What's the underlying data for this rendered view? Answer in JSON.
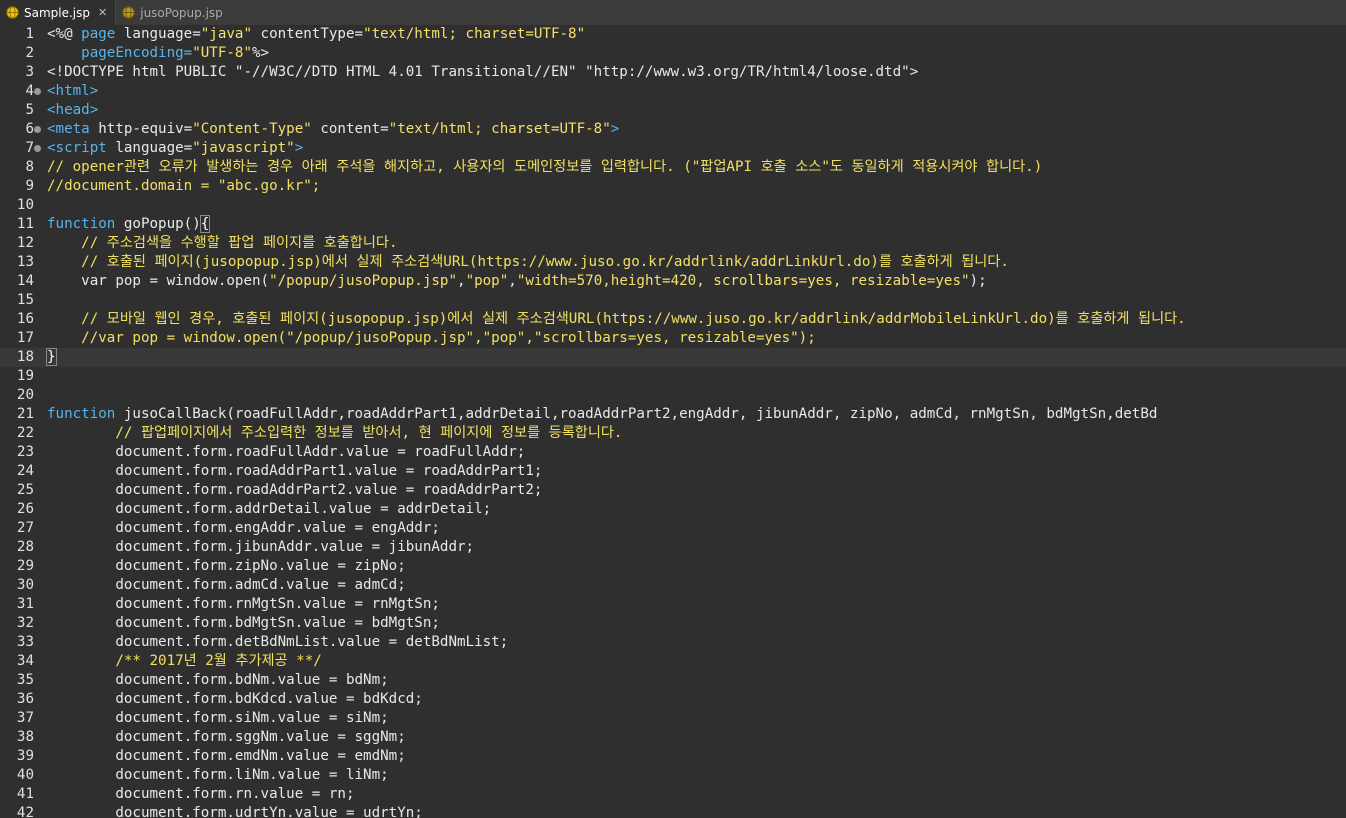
{
  "tabs": [
    {
      "label": "Sample.jsp",
      "icon": "jsp-file-icon",
      "active": true,
      "close": "✕"
    },
    {
      "label": "jusoPopup.jsp",
      "icon": "jsp-file-icon",
      "active": false
    }
  ],
  "colors": {
    "background": "#2f2f2f",
    "line_number": "#e0e0e0",
    "text": "#e8e8e8",
    "string": "#f4e06a",
    "tag": "#58b4ec",
    "comment": "#f0e060"
  },
  "editor": {
    "current_line": 18,
    "folded_lines": [
      4,
      6,
      7
    ],
    "lines": [
      {
        "n": "1",
        "segs": [
          [
            "<%@ ",
            "t-jsp"
          ],
          [
            "page",
            "t-tag"
          ],
          [
            " language=",
            "t-default"
          ],
          [
            "\"java\"",
            "t-str"
          ],
          [
            " contentType=",
            "t-default"
          ],
          [
            "\"text/html; charset=UTF-8\"",
            "t-str"
          ]
        ]
      },
      {
        "n": "2",
        "segs": [
          [
            "    pageEncoding=",
            "t-tag"
          ],
          [
            "\"UTF-8\"",
            "t-str"
          ],
          [
            "%>",
            "t-jsp"
          ]
        ]
      },
      {
        "n": "3",
        "segs": [
          [
            "<!DOCTYPE html PUBLIC \"-//W3C//DTD HTML 4.01 Transitional//EN\" \"http://www.w3.org/TR/html4/loose.dtd\">",
            "t-default"
          ]
        ]
      },
      {
        "n": "4",
        "segs": [
          [
            "<html>",
            "t-tag"
          ]
        ]
      },
      {
        "n": "5",
        "segs": [
          [
            "<head>",
            "t-tag"
          ]
        ]
      },
      {
        "n": "6",
        "segs": [
          [
            "<meta",
            "t-tag"
          ],
          [
            " http-equiv=",
            "t-default"
          ],
          [
            "\"Content-Type\"",
            "t-str"
          ],
          [
            " content=",
            "t-default"
          ],
          [
            "\"text/html; charset=UTF-8\"",
            "t-str"
          ],
          [
            ">",
            "t-tag"
          ]
        ]
      },
      {
        "n": "7",
        "segs": [
          [
            "<script",
            "t-tag"
          ],
          [
            " language=",
            "t-default"
          ],
          [
            "\"javascript\"",
            "t-str"
          ],
          [
            ">",
            "t-tag"
          ]
        ]
      },
      {
        "n": "8",
        "segs": [
          [
            "// opener관련 오류가 발생하는 경우 아래 주석을 해지하고, 사용자의 도메인정보를 입력합니다. (\"팝업API 호출 소스\"도 동일하게 적용시켜야 합니다.)",
            "t-comment"
          ]
        ]
      },
      {
        "n": "9",
        "segs": [
          [
            "//document.domain = \"abc.go.kr\";",
            "t-comment"
          ]
        ]
      },
      {
        "n": "10",
        "segs": []
      },
      {
        "n": "11",
        "segs": [
          [
            "function",
            "t-kw"
          ],
          [
            " goPopup()",
            "t-default"
          ],
          [
            "{",
            "t-brace"
          ]
        ]
      },
      {
        "n": "12",
        "segs": [
          [
            "    // 주소검색을 수행할 팝업 페이지를 호출합니다.",
            "t-comment"
          ]
        ]
      },
      {
        "n": "13",
        "segs": [
          [
            "    // 호출된 페이지(jusopopup.jsp)에서 실제 주소검색URL(https://www.juso.go.kr/addrlink/addrLinkUrl.do)를 호출하게 됩니다.",
            "t-comment"
          ]
        ]
      },
      {
        "n": "14",
        "segs": [
          [
            "    var pop = window.open(",
            "t-default"
          ],
          [
            "\"/popup/jusoPopup.jsp\"",
            "t-str"
          ],
          [
            ",",
            "t-default"
          ],
          [
            "\"pop\"",
            "t-str"
          ],
          [
            ",",
            "t-default"
          ],
          [
            "\"width=570,height=420, scrollbars=yes, resizable=yes\"",
            "t-str"
          ],
          [
            ");",
            "t-default"
          ]
        ]
      },
      {
        "n": "15",
        "segs": []
      },
      {
        "n": "16",
        "segs": [
          [
            "    // 모바일 웹인 경우, 호출된 페이지(jusopopup.jsp)에서 실제 주소검색URL(https://www.juso.go.kr/addrlink/addrMobileLinkUrl.do)를 호출하게 됩니다.",
            "t-comment"
          ]
        ]
      },
      {
        "n": "17",
        "segs": [
          [
            "    //var pop = window.open(\"/popup/jusoPopup.jsp\",\"pop\",\"scrollbars=yes, resizable=yes\");",
            "t-comment"
          ]
        ]
      },
      {
        "n": "18",
        "segs": [
          [
            "}",
            "t-brace"
          ]
        ],
        "caret": true
      },
      {
        "n": "19",
        "segs": []
      },
      {
        "n": "20",
        "segs": []
      },
      {
        "n": "21",
        "segs": [
          [
            "function",
            "t-kw"
          ],
          [
            " jusoCallBack(roadFullAddr,roadAddrPart1,addrDetail,roadAddrPart2,engAddr, jibunAddr, zipNo, admCd, rnMgtSn, bdMgtSn,detBd",
            "t-default"
          ]
        ]
      },
      {
        "n": "22",
        "segs": [
          [
            "        // 팝업페이지에서 주소입력한 정보를 받아서, 현 페이지에 정보를 등록합니다.",
            "t-comment"
          ]
        ]
      },
      {
        "n": "23",
        "segs": [
          [
            "        document.form.roadFullAddr.value = roadFullAddr;",
            "t-default"
          ]
        ]
      },
      {
        "n": "24",
        "segs": [
          [
            "        document.form.roadAddrPart1.value = roadAddrPart1;",
            "t-default"
          ]
        ]
      },
      {
        "n": "25",
        "segs": [
          [
            "        document.form.roadAddrPart2.value = roadAddrPart2;",
            "t-default"
          ]
        ]
      },
      {
        "n": "26",
        "segs": [
          [
            "        document.form.addrDetail.value = addrDetail;",
            "t-default"
          ]
        ]
      },
      {
        "n": "27",
        "segs": [
          [
            "        document.form.engAddr.value = engAddr;",
            "t-default"
          ]
        ]
      },
      {
        "n": "28",
        "segs": [
          [
            "        document.form.jibunAddr.value = jibunAddr;",
            "t-default"
          ]
        ]
      },
      {
        "n": "29",
        "segs": [
          [
            "        document.form.zipNo.value = zipNo;",
            "t-default"
          ]
        ]
      },
      {
        "n": "30",
        "segs": [
          [
            "        document.form.admCd.value = admCd;",
            "t-default"
          ]
        ]
      },
      {
        "n": "31",
        "segs": [
          [
            "        document.form.rnMgtSn.value = rnMgtSn;",
            "t-default"
          ]
        ]
      },
      {
        "n": "32",
        "segs": [
          [
            "        document.form.bdMgtSn.value = bdMgtSn;",
            "t-default"
          ]
        ]
      },
      {
        "n": "33",
        "segs": [
          [
            "        document.form.detBdNmList.value = detBdNmList;",
            "t-default"
          ]
        ]
      },
      {
        "n": "34",
        "segs": [
          [
            "        /** 2017년 2월 추가제공 **/",
            "t-comment"
          ]
        ]
      },
      {
        "n": "35",
        "segs": [
          [
            "        document.form.bdNm.value = bdNm;",
            "t-default"
          ]
        ]
      },
      {
        "n": "36",
        "segs": [
          [
            "        document.form.bdKdcd.value = bdKdcd;",
            "t-default"
          ]
        ]
      },
      {
        "n": "37",
        "segs": [
          [
            "        document.form.siNm.value = siNm;",
            "t-default"
          ]
        ]
      },
      {
        "n": "38",
        "segs": [
          [
            "        document.form.sggNm.value = sggNm;",
            "t-default"
          ]
        ]
      },
      {
        "n": "39",
        "segs": [
          [
            "        document.form.emdNm.value = emdNm;",
            "t-default"
          ]
        ]
      },
      {
        "n": "40",
        "segs": [
          [
            "        document.form.liNm.value = liNm;",
            "t-default"
          ]
        ]
      },
      {
        "n": "41",
        "segs": [
          [
            "        document.form.rn.value = rn;",
            "t-default"
          ]
        ]
      },
      {
        "n": "42",
        "segs": [
          [
            "        document.form.udrtYn.value = udrtYn;",
            "t-default"
          ]
        ]
      }
    ]
  }
}
